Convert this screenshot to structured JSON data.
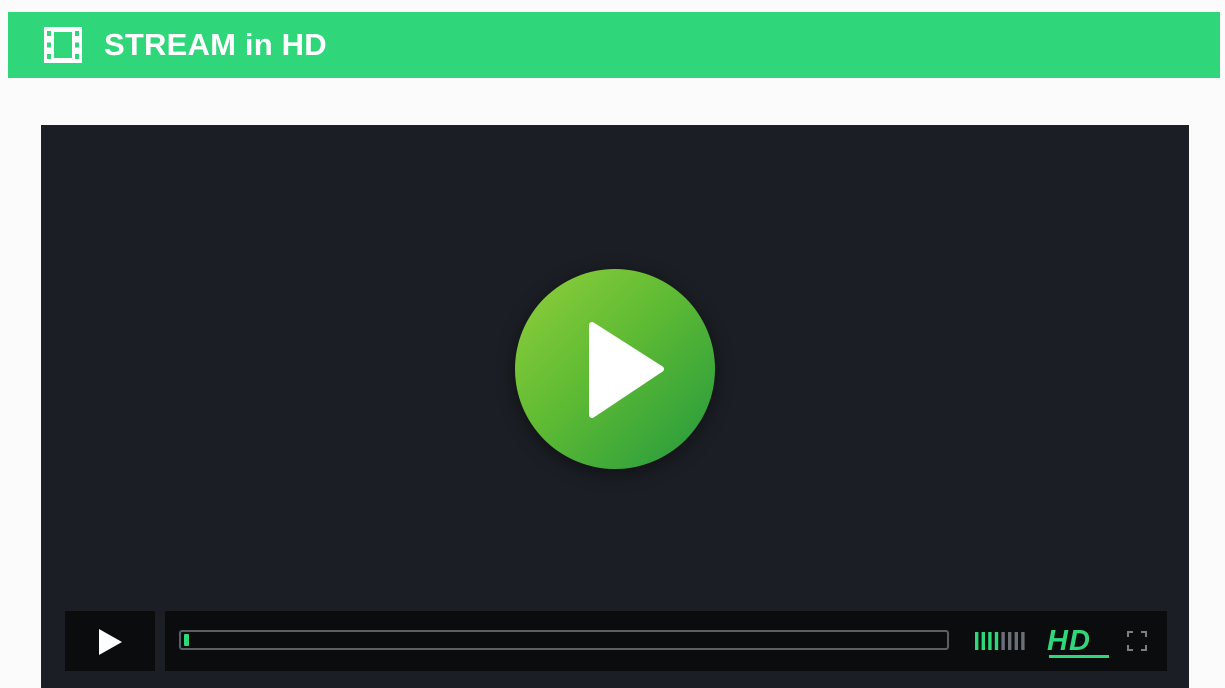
{
  "header": {
    "title": "STREAM in HD",
    "icon": "film-strip-icon",
    "background_color": "#2fd67a"
  },
  "player": {
    "background_color": "#1b1e24",
    "big_play_icon": "play-icon",
    "controls": {
      "play_icon": "play-icon",
      "progress": 0.006,
      "accent_color": "#2fd67a",
      "volume_icon": "volume-bars-icon",
      "volume_level": 0.5,
      "quality_label": "HD",
      "fullscreen_icon": "fullscreen-icon"
    }
  }
}
